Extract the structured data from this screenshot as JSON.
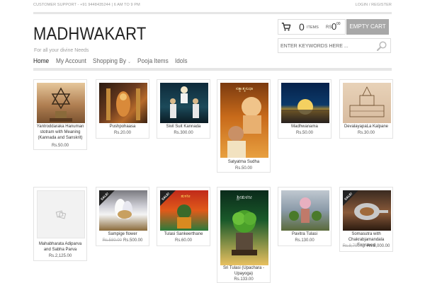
{
  "topbar": {
    "support": "CUSTOMER SUPPORT - +91 9448435244 | 6 AM TO 9 PM",
    "login": "LOGIN / REGISTER"
  },
  "header": {
    "logo": "MADHWAKART",
    "tagline": "For all your divine Needs"
  },
  "cart": {
    "count": "0",
    "items_label": "ITEMS",
    "currency": "RS",
    "amount": "0",
    "decimals": "00",
    "empty_label": "EMPTY CART"
  },
  "search": {
    "placeholder": "ENTER KEYWORDS HERE ..."
  },
  "nav": {
    "home": "Home",
    "account": "My Account",
    "shopping": "Shopping By",
    "pooja": "Pooja Items",
    "idols": "Idols"
  },
  "products": [
    {
      "name": "Yantroddaraka Hanuman stotram with Meaning (Kannada and Sanskrit)",
      "price": "Rs.50.00"
    },
    {
      "name": "Pushpohaasa",
      "price": "Rs.20.00"
    },
    {
      "name": "Sivil Suit Kannada",
      "price": "Rs.300.00"
    },
    {
      "name": "Satyatma Sudha",
      "price": "Rs.50.00"
    },
    {
      "name": "Madhwanama",
      "price": "Rs.50.00"
    },
    {
      "name": "DevalayapaLa Kalpane",
      "price": "Rs.30.00"
    },
    {
      "name": "Mahabharata Adiparva and Sabha Parva",
      "price": "Rs.2,125.00"
    },
    {
      "name": "Sampige flower",
      "old_price": "Rs.580.00",
      "price": "Rs.500.00",
      "badge": "SALE!"
    },
    {
      "name": "Tulasi Sankeerthane",
      "price": "Rs.60.00",
      "badge": "SALE!"
    },
    {
      "name": "Sri Tulasi (Upachara - Upayoga)",
      "price": "Rs.133.00"
    },
    {
      "name": "Pavitra Tulasi",
      "price": "Rs.130.00"
    },
    {
      "name": "Somasutra with Chakrabjamandala Engraved",
      "old_price": "Rs.8,700.00",
      "price": "Rs.8,000.00",
      "badge": "SALE!"
    }
  ],
  "images": {
    "book_title_satyatma": "ಸತ್ಯಾತ್ಮಸುಧಾ",
    "book_title_tulasi": "ಶ್ರೀತುಳಸೀ",
    "book_title_sankeerthane": "ತುಳಸೀ"
  },
  "colors": {
    "accent_gray": "#a8a8a8",
    "rule_gray": "#e6e6e6",
    "sale_badge": "#222222"
  }
}
